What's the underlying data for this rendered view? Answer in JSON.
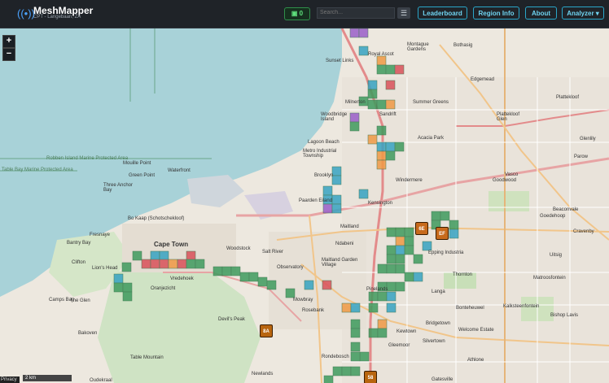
{
  "app": {
    "title": "MeshMapper",
    "subtitle": "CPT - Langebaan, ZA",
    "counter_value": "0"
  },
  "search": {
    "placeholder": "Search..."
  },
  "nav": {
    "leaderboard": "Leaderboard",
    "region_info": "Region Info",
    "about": "About",
    "analyzer": "Analyzer ▾"
  },
  "map_controls": {
    "zoom_in": "+",
    "zoom_out": "−"
  },
  "scale": {
    "label": "2 km"
  },
  "attribution": {
    "privacy": "Privacy"
  },
  "nodes": [
    {
      "id": "6E",
      "color": "#c76a1c"
    },
    {
      "id": "EF",
      "color": "#c76a1c"
    },
    {
      "id": "8A",
      "color": "#b8650f"
    },
    {
      "id": "58",
      "color": "#b8650f"
    }
  ],
  "colors": {
    "cell_green": "#3f9b5e",
    "cell_teal": "#37a3c2",
    "cell_orange": "#f09a45",
    "cell_red": "#d9515a",
    "cell_purple": "#9a5fc9",
    "accent": "#2aa6c9"
  },
  "places": [
    "Sunset Links",
    "Royal Ascot",
    "Montague Gardens",
    "Bothasig",
    "Milnerton",
    "Summer Greens",
    "Edgemead",
    "Woodbridge Island",
    "Sandrift",
    "Plattekloof",
    "Plattekloof Glen",
    "Acacia Park",
    "Lagoon Beach",
    "Metro Industrial Township",
    "Windermere",
    "Robben Island Marine Protected Area",
    "Table Bay Marine Protected Area",
    "Mouille Point",
    "Waterfront",
    "Green Point",
    "Three Anchor Bay",
    "Bo Kaap (Schotschekloof)",
    "Bantry Bay",
    "Fresnaye",
    "Clifton",
    "Cape Town",
    "Woodstock",
    "Salt River",
    "Observatory",
    "Maitland",
    "Ndabeni",
    "Maitland Garden Village",
    "Epping Industria",
    "Goodwood",
    "Vasco",
    "Beaconvale",
    "Matroosfontein",
    "Mowbray",
    "Rosebank",
    "Rondebosch",
    "Langa",
    "Bridgetown",
    "Kewtown",
    "Welcome Estate",
    "Athlone",
    "Silvertown",
    "Newlands",
    "Kalksteenfontein",
    "Bishop Lavis",
    "Oranjezicht",
    "Vredehoek",
    "Camps Bay",
    "The Glen",
    "Bakoven",
    "Brooklyn",
    "Paarden Eiland",
    "Kensington",
    "Goedehoop",
    "Cravenby",
    "Uitsig",
    "Bonteheuwel",
    "Gleemoor",
    "Gatesville",
    "Oudekraal",
    "Lion's Head",
    "Devil's Peak",
    "Table Mountain",
    "Glenlily",
    "Parow",
    "Thornton",
    "Pinelands"
  ]
}
